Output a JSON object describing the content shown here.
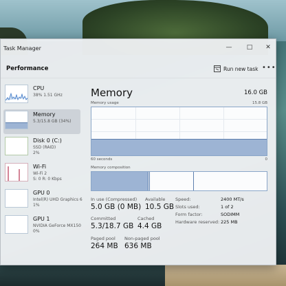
{
  "window": {
    "title": "Task Manager",
    "controls": {
      "minimize": "—",
      "maximize": "□",
      "close": "✕"
    }
  },
  "header": {
    "section_title": "Performance",
    "run_new_task": "Run new task",
    "more": "•••"
  },
  "sidebar": {
    "items": [
      {
        "name": "CPU",
        "sub1": "38%  1.51 GHz",
        "sub2": "",
        "icon": "cpu-graph"
      },
      {
        "name": "Memory",
        "sub1": "5.3/15.8 GB (34%)",
        "sub2": "",
        "icon": "memory-graph"
      },
      {
        "name": "Disk 0 (C:)",
        "sub1": "SSD (RAID)",
        "sub2": "2%",
        "icon": "disk-graph"
      },
      {
        "name": "Wi-Fi",
        "sub1": "Wi-Fi 2",
        "sub2": "S: 0  R: 0 Kbps",
        "icon": "wifi-graph"
      },
      {
        "name": "GPU 0",
        "sub1": "Intel(R) UHD Graphics 6",
        "sub2": "1%",
        "icon": "gpu-graph"
      },
      {
        "name": "GPU 1",
        "sub1": "NVIDIA GeForce MX150",
        "sub2": "0%",
        "icon": "gpu-graph"
      }
    ]
  },
  "memory": {
    "title": "Memory",
    "total": "16.0 GB",
    "usage_label": "Memory usage",
    "usage_max": "15.8 GB",
    "usage_fraction": 0.34,
    "time_label": "60 seconds",
    "time_zero": "0",
    "composition_label": "Memory composition",
    "composition_inuse_fraction": 0.32,
    "composition_modified_fraction": 0.01,
    "composition_standby_fraction": 0.25,
    "stats": {
      "in_use_label": "In use (Compressed)",
      "in_use_value": "5.0 GB (0 MB)",
      "available_label": "Available",
      "available_value": "10.5 GB",
      "committed_label": "Committed",
      "committed_value": "5.3/18.7 GB",
      "cached_label": "Cached",
      "cached_value": "4.4 GB",
      "paged_label": "Paged pool",
      "paged_value": "264 MB",
      "nonpaged_label": "Non-paged pool",
      "nonpaged_value": "636 MB"
    },
    "details": {
      "speed_label": "Speed:",
      "speed_value": "2400 MT/s",
      "slots_label": "Slots used:",
      "slots_value": "1 of 2",
      "form_label": "Form factor:",
      "form_value": "SODIMM",
      "reserved_label": "Hardware reserved:",
      "reserved_value": "225 MB"
    }
  },
  "colors": {
    "accent_fill": "#9db4d4",
    "accent_line": "#5d7fad",
    "cpu_line": "#3d78c7",
    "wifi_line": "#b8324f"
  }
}
